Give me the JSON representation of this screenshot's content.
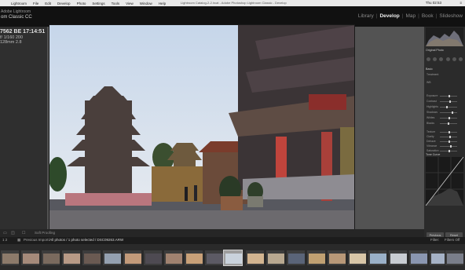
{
  "menubar": {
    "app": "Lightroom",
    "items": [
      "File",
      "Edit",
      "Develop",
      "Photo",
      "Settings",
      "Tools",
      "View",
      "Window",
      "Help"
    ],
    "window_title": "Lightroom Catalog-2-2.lrcat - Adobe Photoshop Lightroom Classic - Develop",
    "clock": "Thu 02:53",
    "status": "≡"
  },
  "identity": {
    "line1": "Adobe Lightroom",
    "line2": "om Classic CC"
  },
  "modules": {
    "items": [
      "Library",
      "Develop",
      "Map",
      "Book",
      "Slideshow"
    ],
    "active": "Develop",
    "sep": "|"
  },
  "photo_info": {
    "line1": "7562 BE 17:14:51",
    "line2": "f/ 1/160 200",
    "line3": "128mm 2.8"
  },
  "right_panel": {
    "histogram_label": "Original Photo",
    "basic_label": "Basic",
    "treatment_label": "Treatment",
    "wb_label": "WB",
    "tone_labels": [
      "Exposure",
      "Contrast",
      "Highlights",
      "Shadows",
      "Whites",
      "Blacks"
    ],
    "presence_labels": [
      "Texture",
      "Clarity",
      "Dehaze",
      "Vibrance",
      "Saturation"
    ],
    "tone_curve_label": "Tone Curve",
    "previous_button": "Previous",
    "reset_button": "Reset"
  },
  "toolbar": {
    "soft_proofing_label": "Soft Proofing"
  },
  "filmstrip": {
    "prefix": "1 2",
    "import_label": "Previous Import",
    "path": "/All photos / 1 photo selected / DSC09263.ARW",
    "filter_label": "Filter:",
    "filter_value": "Filters Off"
  },
  "colors": {
    "active_module": "#ededed",
    "inactive_module": "#8a8a8a",
    "canvas": "#535353"
  }
}
